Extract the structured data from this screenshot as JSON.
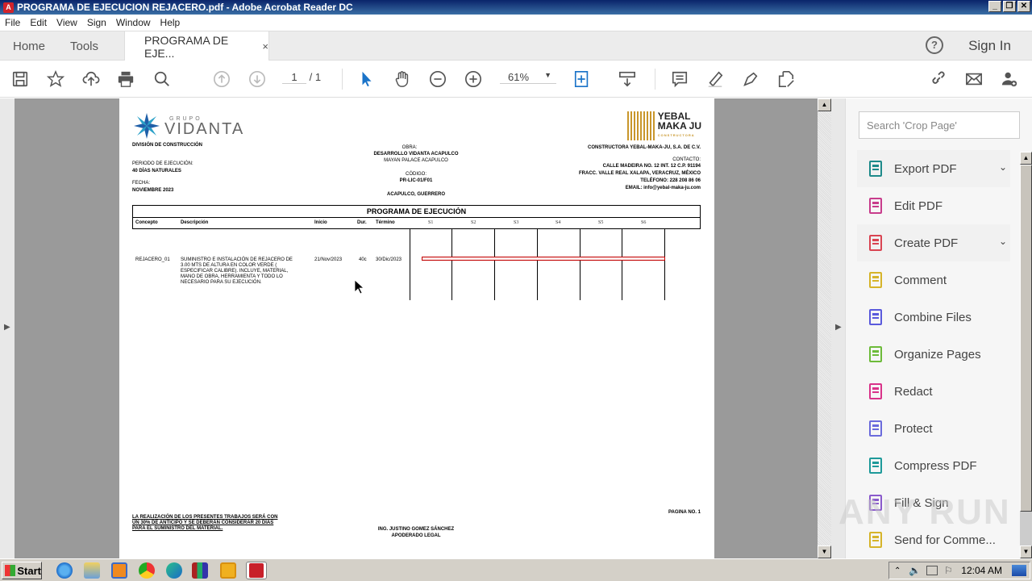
{
  "window": {
    "title": "PROGRAMA DE EJECUCION REJACERO.pdf - Adobe Acrobat Reader DC",
    "controls": [
      "_",
      "❐",
      "✕"
    ]
  },
  "menu": [
    "File",
    "Edit",
    "View",
    "Sign",
    "Window",
    "Help"
  ],
  "tabs": {
    "home": "Home",
    "tools": "Tools",
    "document": "PROGRAMA DE EJE...",
    "close": "×",
    "help": "?",
    "sign_in": "Sign In"
  },
  "toolbar": {
    "page_current": "1",
    "page_total": "/ 1",
    "zoom": "61%"
  },
  "document": {
    "left_logo": {
      "grupo": "GRUPO",
      "name": "VIDANTA"
    },
    "division": "DIVISIÓN DE CONSTRUCCIÓN",
    "periodo_label": "PERIODO DE EJECUCIÓN:",
    "periodo_value": "40 DÍAS NATURALES",
    "fecha_label": "FECHA:",
    "fecha_value": "NOVIEMBRE 2023",
    "obra_label": "OBRA:",
    "obra_line1": "DESARROLLO VIDANTA ACAPULCO",
    "obra_line2": "MAYAN PALACE ACAPULCO",
    "codigo_label": "CÓDIGO:",
    "codigo_value": "PR-LIC-01/F01",
    "location": "ACAPULCO, GUERRERO",
    "right_logo": {
      "line1": "YEBAL",
      "line2": "MAKA JU",
      "sub": "CONSTRUCTORA"
    },
    "company": "CONSTRUCTORA YEBAL-MAKA-JU, S.A. DE C.V.",
    "contacto_label": "CONTACTO:",
    "address1": "CALLE MADEIRA NO. 12 INT. 12   C.P. 91194",
    "address2": "FRACC. VALLE REAL   XALAPA, VERACRUZ, MÉXICO",
    "phone": "TELÉFONO: 228 208 86 06",
    "email": "EMAIL: info@yebal-maka-ju.com",
    "table_title": "PROGRAMA DE EJECUCIÓN",
    "columns": [
      "Concepto",
      "Descripción",
      "Inicio",
      "Dur.",
      "Término"
    ],
    "weeks": [
      "S1",
      "S2",
      "S3",
      "S4",
      "S5",
      "S6"
    ],
    "rows": [
      {
        "concepto": "REJACERO_01",
        "descripcion": [
          "SUMINISTRO E INSTALACIÓN DE REJACERO DE",
          "3.00 MTS DE ALTURA EN COLOR VERDE (",
          "ESPECIFICAR CALIBRE). INCLUYE, MATERIAL,",
          "MANO DE OBRA, HERRAMIENTA Y TODO LO",
          "NECESARIO PARA SU EJECUCIÓN."
        ],
        "inicio": "21/Nov/2023",
        "dur": "40c",
        "termino": "30/Dic/2023",
        "bar_start_week": 0.2,
        "bar_end_week": 6.0
      }
    ],
    "footer_note": [
      "LA REALIZACIÓN DE LOS PRESENTES TRABAJOS SERÁ CON",
      "UN 30% DE ANTICIPO Y SE DEBERÁN CONSIDERAR 20 DÍAS",
      "PARA EL SUMINISTRO DEL MATERIAL."
    ],
    "signer_name": "ING. JUSTINO GOMEZ SÁNCHEZ",
    "signer_title": "APODERADO LEGAL",
    "page_label": "PAGINA NO. 1"
  },
  "sidepanel": {
    "search_placeholder": "Search 'Crop Page'",
    "tools": [
      {
        "label": "Export PDF",
        "icon": "export-pdf-icon",
        "color": "#1e8a8a",
        "expandable": true
      },
      {
        "label": "Edit PDF",
        "icon": "edit-pdf-icon",
        "color": "#c83c8c",
        "expandable": false
      },
      {
        "label": "Create PDF",
        "icon": "create-pdf-icon",
        "color": "#d94452",
        "expandable": true
      },
      {
        "label": "Comment",
        "icon": "comment-icon",
        "color": "#d6b42a",
        "expandable": false
      },
      {
        "label": "Combine Files",
        "icon": "combine-files-icon",
        "color": "#5a5adc",
        "expandable": false
      },
      {
        "label": "Organize Pages",
        "icon": "organize-pages-icon",
        "color": "#6dbb3a",
        "expandable": false
      },
      {
        "label": "Redact",
        "icon": "redact-icon",
        "color": "#d9338a",
        "expandable": false
      },
      {
        "label": "Protect",
        "icon": "protect-icon",
        "color": "#6b6bdc",
        "expandable": false
      },
      {
        "label": "Compress PDF",
        "icon": "compress-pdf-icon",
        "color": "#1e9a9a",
        "expandable": false
      },
      {
        "label": "Fill & Sign",
        "icon": "fill-sign-icon",
        "color": "#8a5acc",
        "expandable": false
      },
      {
        "label": "Send for Comme...",
        "icon": "send-for-comment-icon",
        "color": "#d6b42a",
        "expandable": false
      }
    ],
    "chevron": "⌄"
  },
  "watermark": "ANY RUN",
  "taskbar": {
    "start": "Start",
    "clock": "12:04 AM"
  }
}
